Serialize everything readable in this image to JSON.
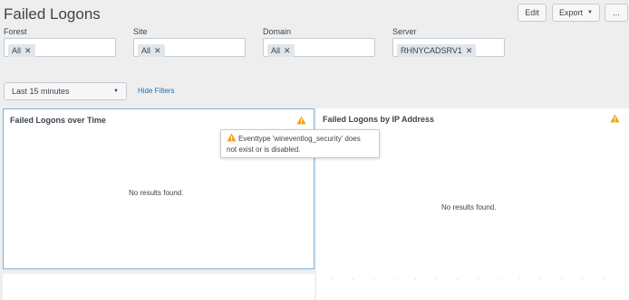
{
  "header": {
    "title": "Failed Logons",
    "edit_label": "Edit",
    "export_label": "Export",
    "more_label": "..."
  },
  "filters": [
    {
      "label": "Forest",
      "token": "All"
    },
    {
      "label": "Site",
      "token": "All"
    },
    {
      "label": "Domain",
      "token": "All"
    },
    {
      "label": "Server",
      "token": "RHNYCADSRV1"
    }
  ],
  "time_picker": {
    "value": "Last 15 minutes"
  },
  "hide_filters_label": "Hide Filters",
  "panels": [
    {
      "title": "Failed Logons over Time",
      "message": "No results found."
    },
    {
      "title": "Failed Logons by IP Address",
      "message": "No results found."
    }
  ],
  "tooltip": {
    "line1": "Eventtype 'wineventlog_security' does",
    "line2": "not exist or is disabled."
  },
  "icons": {
    "remove": "close-x-icon",
    "dropdown": "caret-down-icon",
    "warning": "warning-triangle-icon"
  },
  "colors": {
    "warning": "#f1a31d",
    "link": "#1e6fb6",
    "selected_border": "#7fb2db"
  }
}
